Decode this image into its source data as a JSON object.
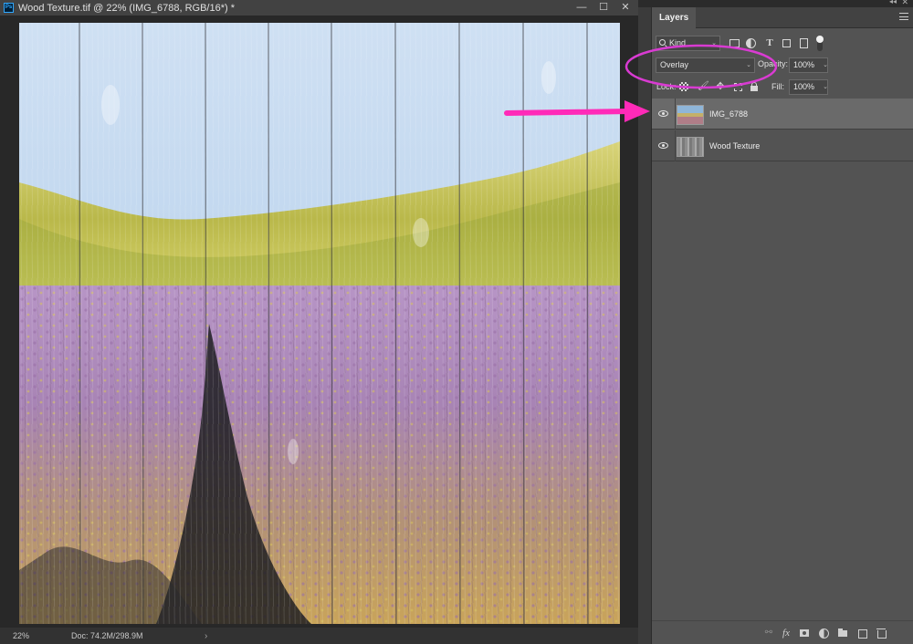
{
  "document": {
    "title": "Wood Texture.tif @ 22% (IMG_6788, RGB/16*) *",
    "app_badge": "Ps",
    "window_controls": {
      "minimize": "—",
      "maximize": "☐",
      "close": "✕"
    }
  },
  "status_bar": {
    "zoom": "22%",
    "doc_info": "Doc: 74.2M/298.9M",
    "chevron": "›"
  },
  "panel": {
    "collapse_glyph": "◂◂",
    "close_glyph": "✕"
  },
  "layers_panel": {
    "tab_label": "Layers",
    "filter": {
      "kind_label": "Kind",
      "caret": "⌄"
    },
    "blend_mode": {
      "value": "Overlay",
      "caret": "⌄"
    },
    "opacity": {
      "label": "Opacity:",
      "value": "100%",
      "caret": "⌄"
    },
    "lock": {
      "label": "Lock:",
      "paint_glyph": "🖌",
      "move_glyph": "✥"
    },
    "fill": {
      "label": "Fill:",
      "value": "100%",
      "caret": "⌄"
    },
    "filter_type_glyph": "T",
    "layers": [
      {
        "name": "IMG_6788",
        "visible": true,
        "selected": true
      },
      {
        "name": "Wood Texture",
        "visible": true,
        "selected": false
      }
    ],
    "footer": {
      "link_glyph": "⚯",
      "fx_label": "fx"
    }
  },
  "annotations": {
    "ellipse_color": "#d93bd2",
    "arrow_color": "#ff2ab8"
  },
  "colors": {
    "app_bg": "#282828",
    "panel_bg": "#535353",
    "selected_layer_bg": "#6a6a6a",
    "title_bar_bg": "#424242"
  }
}
